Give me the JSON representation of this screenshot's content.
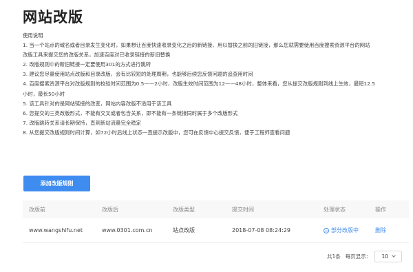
{
  "page": {
    "title": "网站改版"
  },
  "instructions": {
    "heading": "使用说明",
    "lines": [
      "1. 当一个站点的域名或者目录发生变化时，如果想让百度快速收录变化之后的新链接、用以替换之前的旧链接，那么您就需要使用百度搜索资源平台的网站",
      "改版工具来提交您的改版关系，加速百度对已收录链接的新旧替换",
      "2. 改版规则中的新旧链接一定要使用301的方式进行跳转",
      "3. 建议您尽量使用站点改版和目录改版，会有比较短的处理周期，也能够后续您反馈问题的追查用时间",
      "4. 百度搜索资源平台对改版规则的校验时间范围为0.5——2小时，改版生效时间范围为12——48小时，整体来看，您从提交改版规则到线上生效，最短12.5",
      "小时，最长50小时",
      "5. 该工具针对的是网站链接的改变，网站内容改版不适用于该工具",
      "6. 您提交的三类改版形式，不能有交叉或者包含关系，即不能有一条链接同时属于多个改版形式",
      "7. 改版跳转关系请长期保持，直到新站流量完全稳定",
      "8. 从您提交改版规则时间计算，如72小时后线上状态一直提示改版中，您可在反馈中心提交反馈，便于工程师查看问题"
    ]
  },
  "actions": {
    "add_rule_label": "添加改版规则"
  },
  "table": {
    "headers": [
      "改版前",
      "改版后",
      "改版类型",
      "提交时间",
      "处理状态",
      "操作"
    ],
    "rows": [
      {
        "before": "www.wangshifu.net",
        "after": "www.0301.com.cn",
        "type": "站点改版",
        "time": "2018-07-08 08:24:29",
        "status": "部分改版中",
        "status_icon": "minus-circle-icon",
        "action": "删除"
      }
    ]
  },
  "pagination": {
    "total_label": "共1条",
    "page_size_label": "每页显示：",
    "page_size_value": "10",
    "dropdown_icon": "chevron-down-icon"
  },
  "colors": {
    "accent": "#3f8cf1",
    "header_bg": "#f8f8f8",
    "text": "#444444"
  }
}
